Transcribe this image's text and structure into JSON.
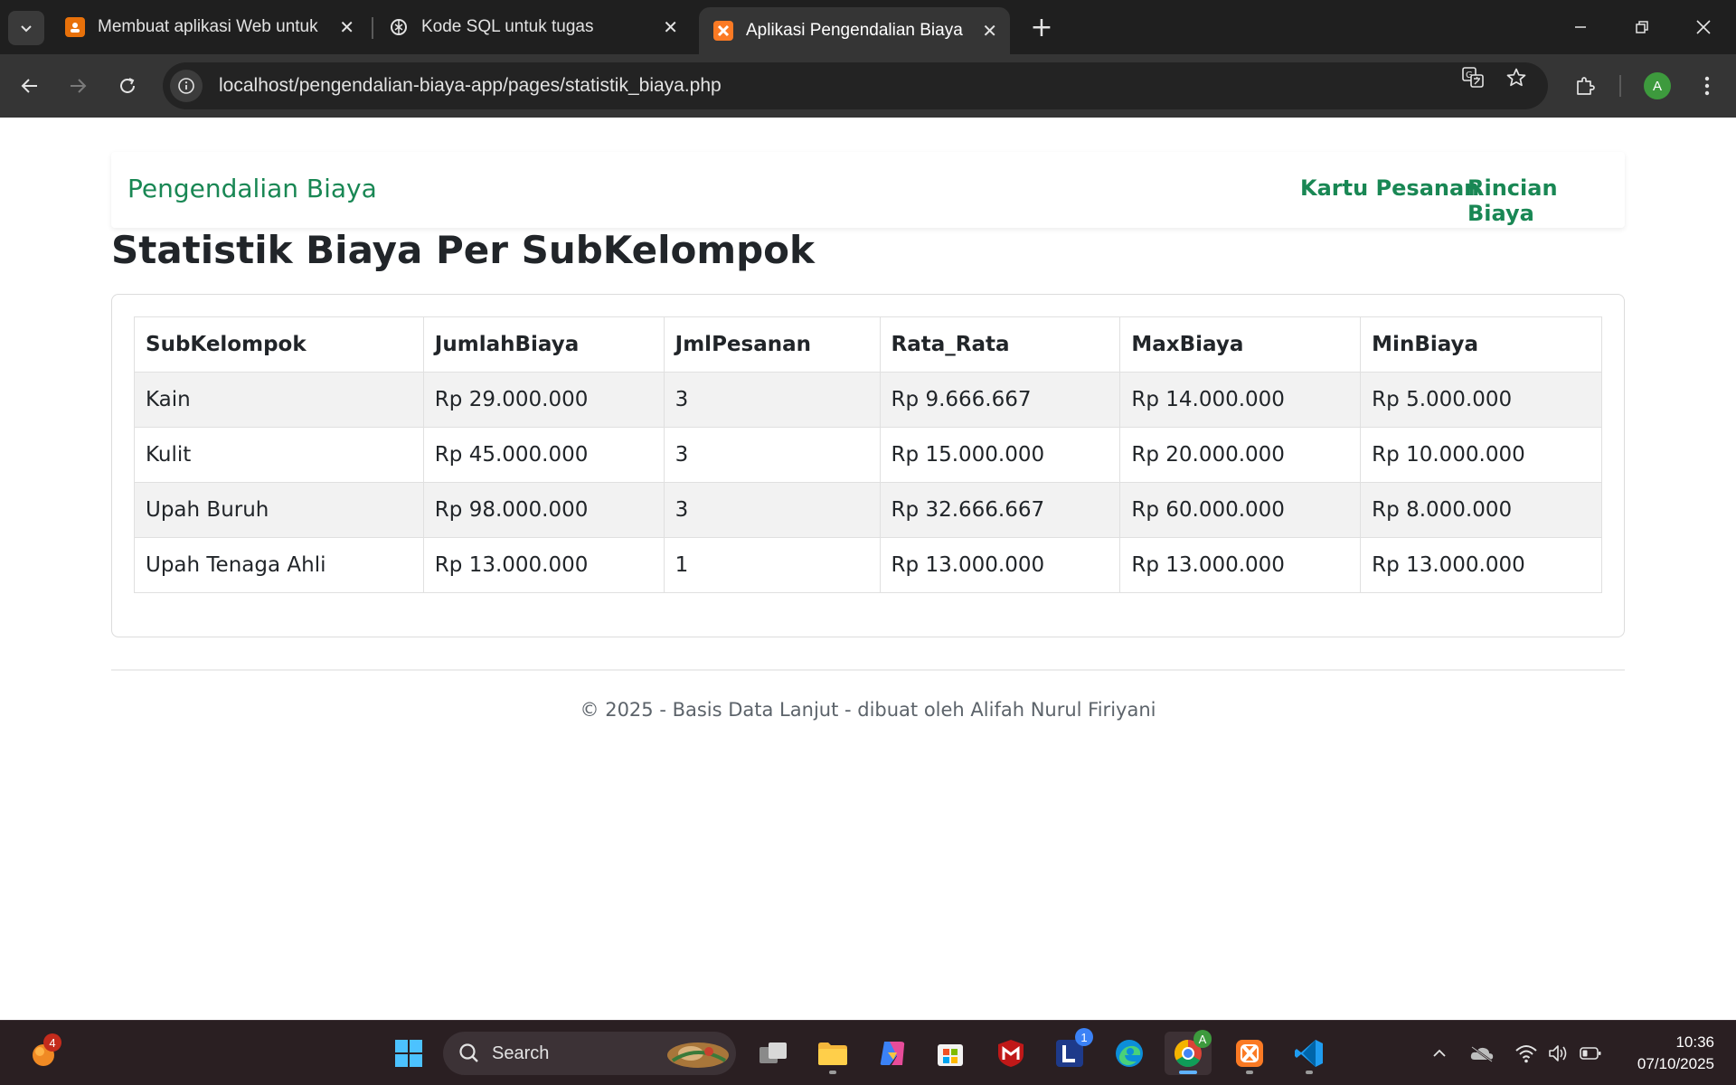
{
  "browser": {
    "tabs": [
      {
        "title": "Membuat aplikasi Web untuk P...",
        "icon": "slides-icon"
      },
      {
        "title": "Kode SQL untuk tugas",
        "icon": "chatgpt-icon"
      },
      {
        "title": "Aplikasi Pengendalian Biaya",
        "icon": "xampp-icon",
        "active": true
      }
    ],
    "url": "localhost/pengendalian-biaya-app/pages/statistik_biaya.php",
    "profile_initial": "A"
  },
  "page": {
    "brand": "Pengendalian Biaya",
    "nav": [
      "Kartu Pesanan",
      "Rincian Biaya"
    ],
    "heading": "Statistik Biaya Per SubKelompok",
    "table": {
      "columns": [
        "SubKelompok",
        "JumlahBiaya",
        "JmlPesanan",
        "Rata_Rata",
        "MaxBiaya",
        "MinBiaya"
      ],
      "rows": [
        [
          "Kain",
          "Rp 29.000.000",
          "3",
          "Rp 9.666.667",
          "Rp 14.000.000",
          "Rp 5.000.000"
        ],
        [
          "Kulit",
          "Rp 45.000.000",
          "3",
          "Rp 15.000.000",
          "Rp 20.000.000",
          "Rp 10.000.000"
        ],
        [
          "Upah Buruh",
          "Rp 98.000.000",
          "3",
          "Rp 32.666.667",
          "Rp 60.000.000",
          "Rp 8.000.000"
        ],
        [
          "Upah Tenaga Ahli",
          "Rp 13.000.000",
          "1",
          "Rp 13.000.000",
          "Rp 13.000.000",
          "Rp 13.000.000"
        ]
      ]
    },
    "footer": "© 2025 - Basis Data Lanjut - dibuat oleh Alifah Nurul Firiyani"
  },
  "taskbar": {
    "search_label": "Search",
    "notification_badge": "4",
    "app_badge": "1",
    "chrome_badge": "A",
    "time": "10:36",
    "date": "07/10/2025"
  },
  "colors": {
    "brand_green": "#198754",
    "chrome_dark": "#1f1f1f",
    "toolbar": "#353535"
  }
}
